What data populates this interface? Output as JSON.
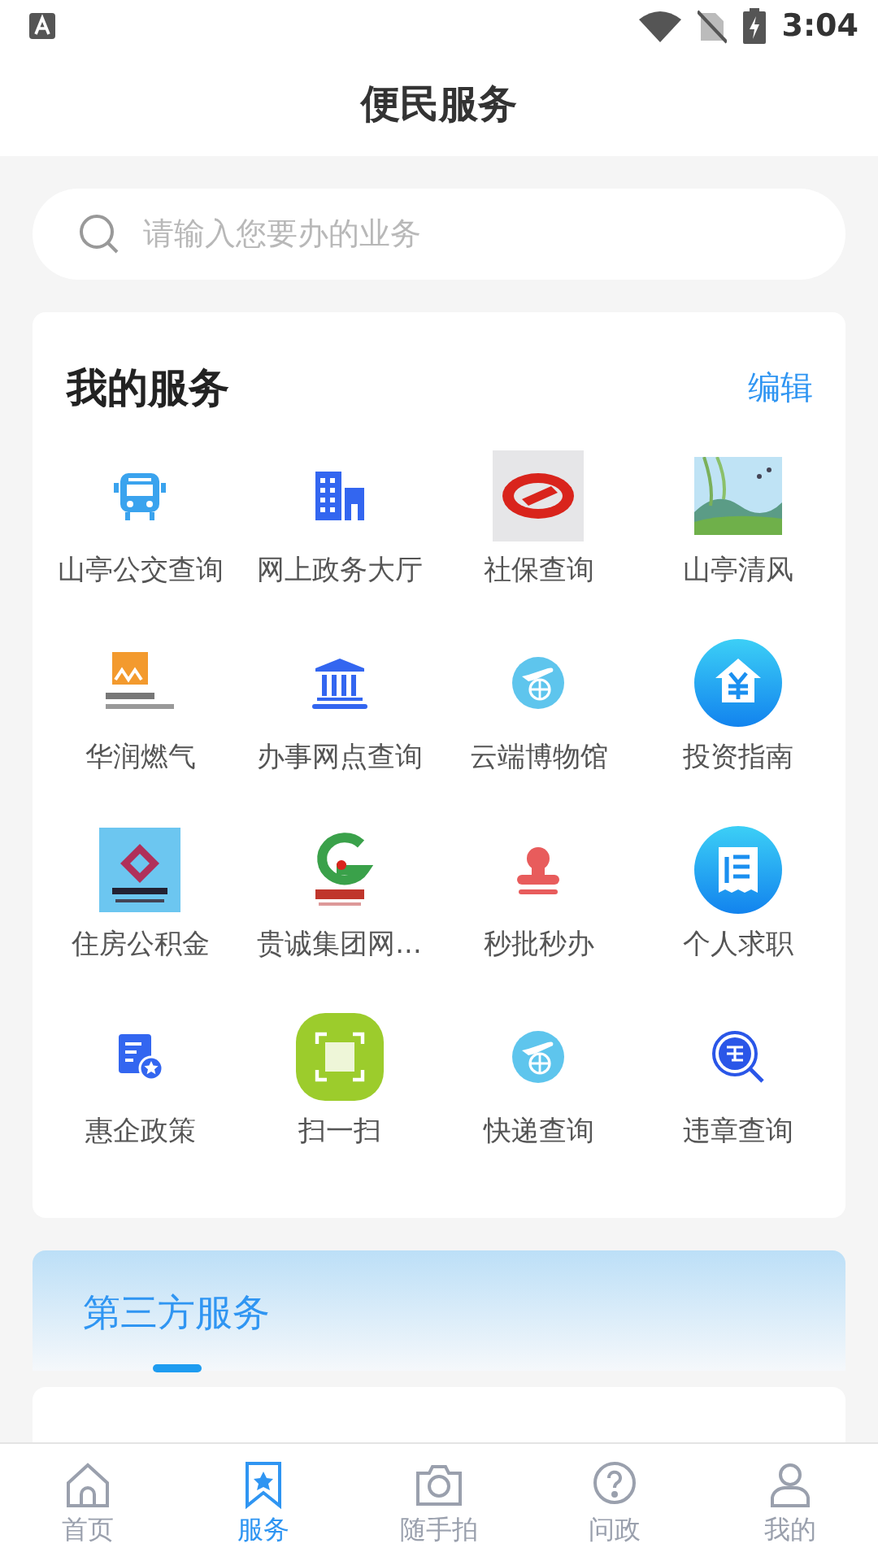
{
  "status_bar": {
    "time": "3:04"
  },
  "title": "便民服务",
  "search": {
    "placeholder": "请输入您要办的业务"
  },
  "my_services": {
    "title": "我的服务",
    "action": "编辑",
    "items": [
      {
        "label": "山亭公交查询",
        "kind": "bus"
      },
      {
        "label": "网上政务大厅",
        "kind": "building"
      },
      {
        "label": "社保查询",
        "kind": "red-logo"
      },
      {
        "label": "山亭清风",
        "kind": "picture"
      },
      {
        "label": "华润燃气",
        "kind": "gas-logo"
      },
      {
        "label": "办事网点查询",
        "kind": "bank"
      },
      {
        "label": "云端博物馆",
        "kind": "plane-globe"
      },
      {
        "label": "投资指南",
        "kind": "yen-house"
      },
      {
        "label": "住房公积金",
        "kind": "fund-logo"
      },
      {
        "label": "贵诚集团网...",
        "kind": "green-logo"
      },
      {
        "label": "秒批秒办",
        "kind": "stamp"
      },
      {
        "label": "个人求职",
        "kind": "receipt"
      },
      {
        "label": "惠企政策",
        "kind": "doc-star"
      },
      {
        "label": "扫一扫",
        "kind": "scan"
      },
      {
        "label": "快递查询",
        "kind": "plane-globe"
      },
      {
        "label": "违章查询",
        "kind": "magnifier"
      }
    ]
  },
  "third_party": {
    "tabs": [
      {
        "label": "第三方服务",
        "selected": true
      }
    ]
  },
  "nav": [
    {
      "label": "首页",
      "kind": "home",
      "selected": false
    },
    {
      "label": "服务",
      "kind": "bookmark",
      "selected": true
    },
    {
      "label": "随手拍",
      "kind": "camera",
      "selected": false
    },
    {
      "label": "问政",
      "kind": "question",
      "selected": false
    },
    {
      "label": "我的",
      "kind": "user",
      "selected": false
    }
  ]
}
